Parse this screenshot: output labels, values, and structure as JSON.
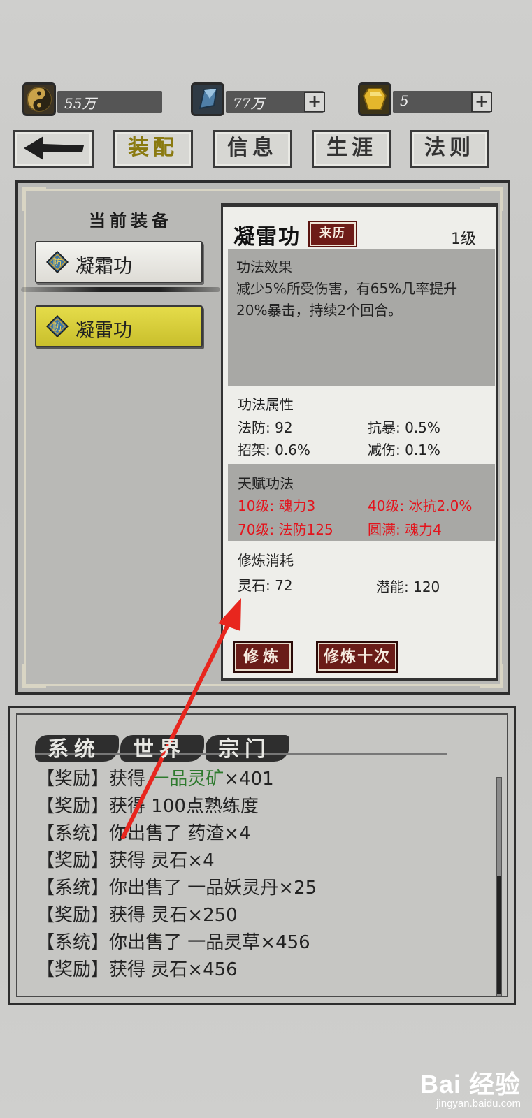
{
  "resources": [
    {
      "icon": "taiji-icon",
      "value": "55万",
      "has_plus": false
    },
    {
      "icon": "blue-crystal-icon",
      "value": "77万",
      "has_plus": true
    },
    {
      "icon": "gold-gem-icon",
      "value": "5",
      "has_plus": true
    }
  ],
  "nav": {
    "back_icon": "back-arrow-icon",
    "tabs": [
      "装配",
      "信息",
      "生涯",
      "法则"
    ],
    "active": "装配"
  },
  "equip": {
    "title": "当前装备",
    "slots": [
      {
        "badge": "防",
        "name": "凝霜功",
        "selected": false
      },
      {
        "badge": "防",
        "name": "凝雷功",
        "selected": true
      }
    ]
  },
  "detail": {
    "name": "凝雷功",
    "origin_button": "来历",
    "level": "1级",
    "effect": {
      "heading": "功法效果",
      "text_line1": "减少5%所受伤害，有65%几率提升",
      "text_line2": "20%暴击，持续2个回合。"
    },
    "attributes": {
      "heading": "功法属性",
      "items": [
        "法防: 92",
        "抗暴: 0.5%",
        "招架: 0.6%",
        "减伤: 0.1%"
      ]
    },
    "talent": {
      "heading": "天赋功法",
      "items": [
        "10级: 魂力3",
        "40级: 冰抗2.0%",
        "70级: 法防125",
        "圆满: 魂力4"
      ]
    },
    "cost": {
      "heading": "修炼消耗",
      "items": [
        "灵石: 72",
        "潜能: 120"
      ]
    },
    "buttons": {
      "train": "修炼",
      "train_ten": "修炼十次"
    }
  },
  "chat": {
    "tabs": [
      "系统",
      "世界",
      "宗门"
    ],
    "messages": [
      {
        "tag": "【奖励】",
        "pre": "获得 ",
        "item": "一品灵矿",
        "post": "×401",
        "item_color": "#2e7a2e"
      },
      {
        "tag": "【奖励】",
        "pre": "获得 ",
        "item": "100点熟练度",
        "post": ""
      },
      {
        "tag": "【系统】",
        "pre": "你出售了 ",
        "item": "药渣",
        "post": "×4"
      },
      {
        "tag": "【奖励】",
        "pre": "获得 ",
        "item": "灵石",
        "post": "×4"
      },
      {
        "tag": "【系统】",
        "pre": "你出售了 ",
        "item": "一品妖灵丹",
        "post": "×25"
      },
      {
        "tag": "【奖励】",
        "pre": "获得 ",
        "item": "灵石",
        "post": "×250"
      },
      {
        "tag": "【系统】",
        "pre": "你出售了 ",
        "item": "一品灵草",
        "post": "×456"
      },
      {
        "tag": "【奖励】",
        "pre": "获得 ",
        "item": "灵石",
        "post": "×456"
      }
    ]
  },
  "watermark": {
    "main": "Bai 经验",
    "sub": "jingyan.baidu.com"
  },
  "colors": {
    "accent_red": "#e3141c",
    "button_maroon": "#6a1c18",
    "selected_yellow": "#d4ca36",
    "arrow_red": "#e8261e"
  }
}
